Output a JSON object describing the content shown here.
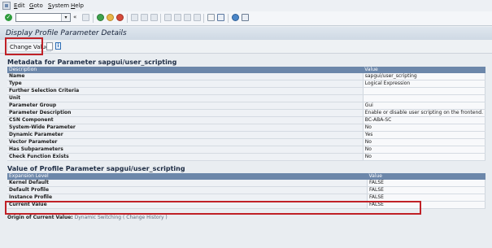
{
  "menu": [
    "Edit",
    "Goto",
    "System",
    "Help"
  ],
  "toolbar": {
    "command_value": "",
    "command_placeholder": ""
  },
  "header": {
    "title": "Display Profile Parameter Details"
  },
  "actions": {
    "change_value_label": "Change Value"
  },
  "metadata": {
    "title": "Metadata for Parameter sapgui/user_scripting",
    "columns": [
      "Description",
      "Value"
    ],
    "rows": [
      [
        "Name",
        "sapgui/user_scripting"
      ],
      [
        "Type",
        "Logical Expression"
      ],
      [
        "Further Selection Criteria",
        ""
      ],
      [
        "Unit",
        ""
      ],
      [
        "Parameter Group",
        "Gui"
      ],
      [
        "Parameter Description",
        "Enable or disable user scripting on the frontend."
      ],
      [
        "CSN Component",
        "BC-ABA-SC"
      ],
      [
        "System-Wide Parameter",
        "No"
      ],
      [
        "Dynamic Parameter",
        "Yes"
      ],
      [
        "Vector Parameter",
        "No"
      ],
      [
        "Has Subparameters",
        "No"
      ],
      [
        "Check Function Exists",
        "No"
      ]
    ]
  },
  "values": {
    "title": "Value of Profile Parameter sapgui/user_scripting",
    "columns": [
      "Expansion Level",
      "Value"
    ],
    "rows": [
      [
        "Kernel Default",
        "FALSE"
      ],
      [
        "Default Profile",
        "FALSE"
      ],
      [
        "Instance Profile",
        "FALSE"
      ],
      [
        "Current Value",
        "FALSE"
      ]
    ]
  },
  "origin": {
    "label": "Origin of Current Value:",
    "value": "Dynamic Switching",
    "link": "( Change History )"
  }
}
